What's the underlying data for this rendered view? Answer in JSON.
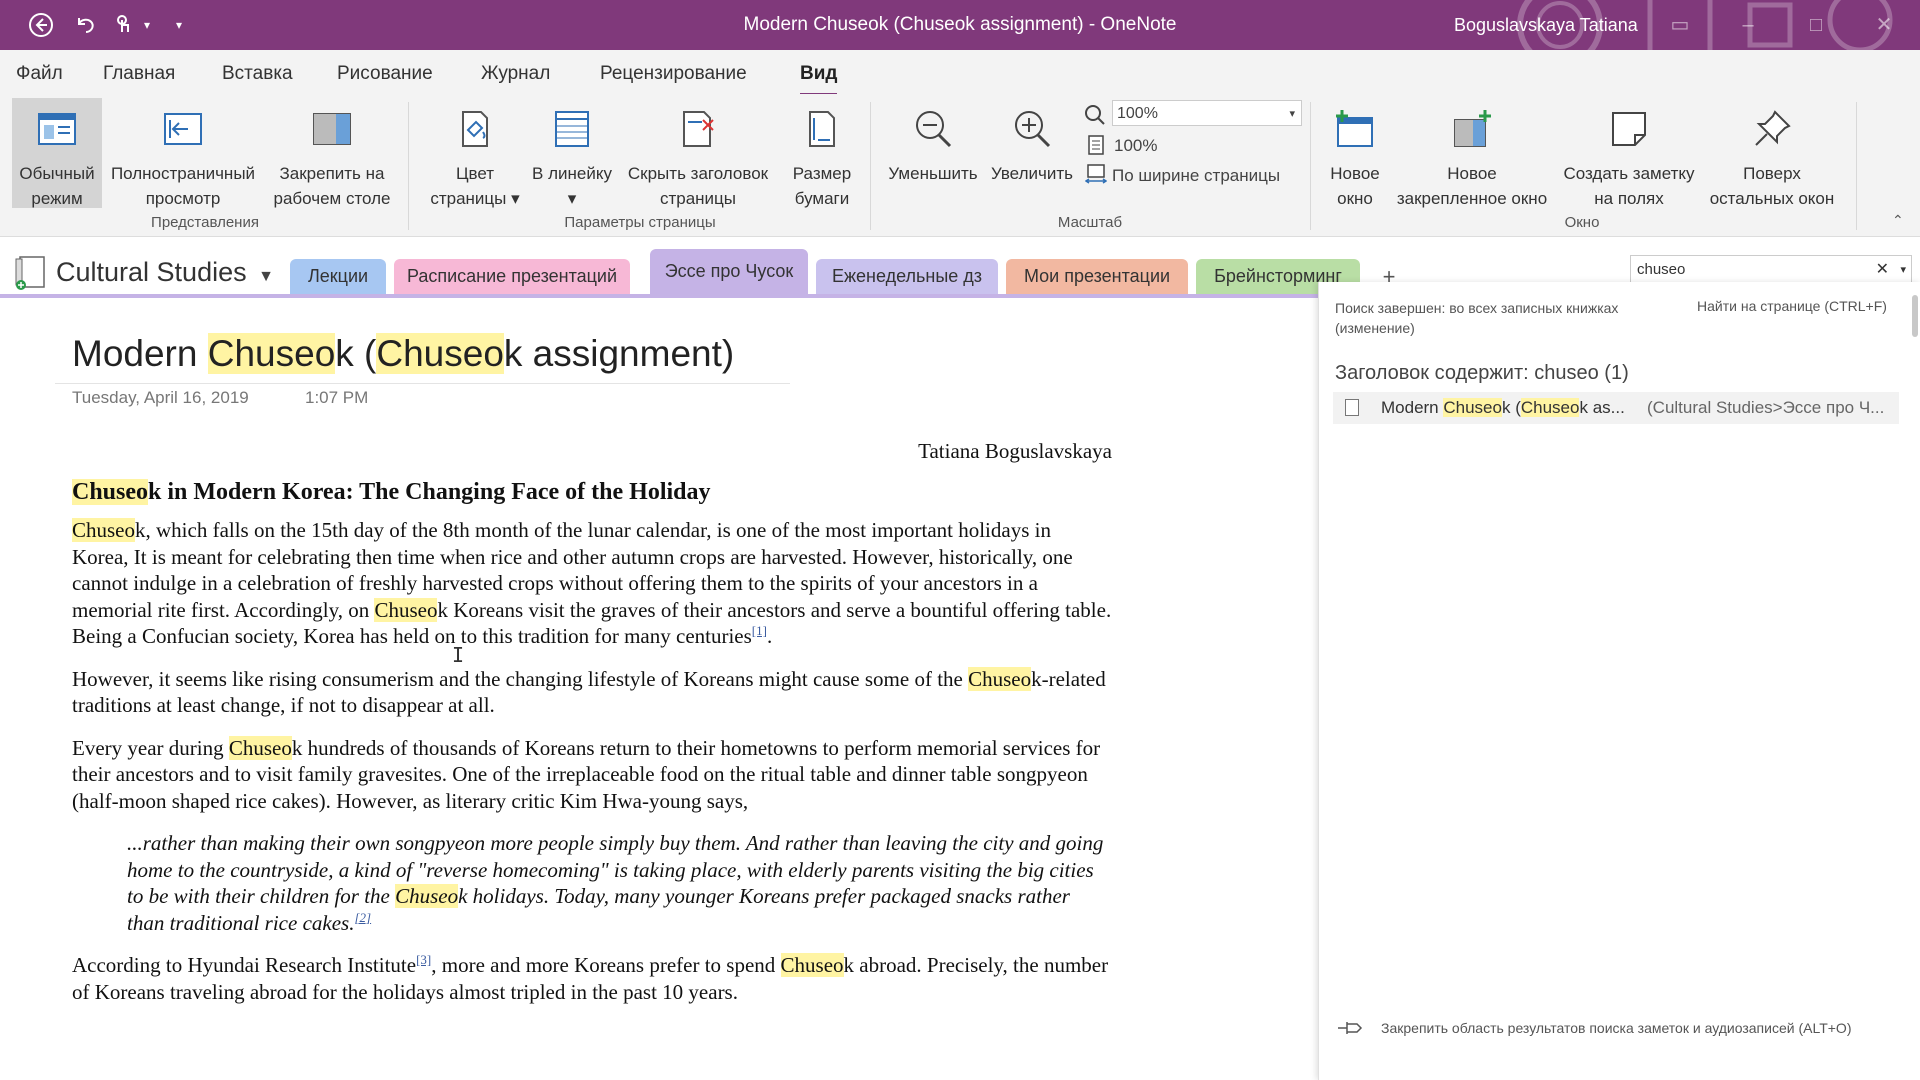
{
  "titlebar": {
    "title": "Modern Chuseok (Chuseok assignment)  -  OneNote",
    "user": "Boguslavskaya Tatiana",
    "quick_access": [
      "back-icon",
      "undo-icon",
      "touch-mode-icon",
      "dropdown-icon",
      "customize-icon"
    ]
  },
  "menu": [
    "Файл",
    "Главная",
    "Вставка",
    "Рисование",
    "Журнал",
    "Рецензирование",
    "Вид"
  ],
  "ribbon": {
    "buttons": [
      {
        "line1": "Обычный",
        "line2": "режим"
      },
      {
        "line1": "Полностраничный",
        "line2": "просмотр"
      },
      {
        "line1": "Закрепить на",
        "line2": "рабочем столе"
      },
      {
        "line1": "Цвет",
        "line2": "страницы ▾"
      },
      {
        "line1": "В линейку",
        "line2": "▾"
      },
      {
        "line1": "Скрыть заголовок",
        "line2": "страницы"
      },
      {
        "line1": "Размер",
        "line2": "бумаги"
      },
      {
        "line1": "Уменьшить",
        "line2": ""
      },
      {
        "line1": "Увеличить",
        "line2": ""
      },
      {
        "line1": "Новое",
        "line2": "окно"
      },
      {
        "line1": "Новое",
        "line2": "закрепленное окно"
      },
      {
        "line1": "Создать заметку",
        "line2": "на полях"
      },
      {
        "line1": "Поверх",
        "line2": "остальных окон"
      }
    ],
    "zoom_value": "100%",
    "zoom_100": "100%",
    "page_width": "По ширине страницы",
    "groups": [
      "Представления",
      "Параметры страницы",
      "Масштаб",
      "Окно"
    ]
  },
  "notebook": {
    "name": "Cultural Studies",
    "sections": [
      {
        "label": "Лекции",
        "color": "#a7c7f2"
      },
      {
        "label": "Расписание презентаций",
        "color": "#f7b8d6"
      },
      {
        "label": "Эссе про Чусок",
        "color": "#c5b3e6"
      },
      {
        "label": "Еженедельные дз",
        "color": "#c9c2ee"
      },
      {
        "label": "Мои презентации",
        "color": "#f2b8a1"
      },
      {
        "label": "Брейнсторминг",
        "color": "#b9dea5"
      }
    ],
    "add_section": "+",
    "search_value": "chuseo"
  },
  "page": {
    "title": {
      "hl1": "Chuseo",
      "t1": "Modern ",
      "t2": "k (",
      "hl2": "Chuseo",
      "t3": "k assignment)"
    },
    "date": "Tuesday, April 16, 2019",
    "time": "1:07 PM",
    "author": "Tatiana Boguslavskaya",
    "heading": {
      "hl": "Chuseo",
      "rest": "k in Modern Korea: The Changing Face of the Holiday"
    },
    "p1": {
      "hl1": "Chuseo",
      "a": "k, which falls on the 15th day of the 8th month of the lunar calendar, is one of the most important holidays in Korea, It is meant for celebrating then time when rice and other autumn crops are harvested. However, historically, one cannot indulge in a celebration of freshly harvested crops without offering them to the spirits of your ancestors in a memorial rite first. Accordingly, on ",
      "hl2": "Chuseo",
      "b": "k Koreans visit the graves of their ancestors and serve a bountiful offering table. Being a Confucian society, Korea has held on to this tradition for many centuries",
      "fn": "[1]",
      "c": "."
    },
    "p2": {
      "a": "However, it seems like rising consumerism and the changing lifestyle of Koreans might cause some of the ",
      "hl": "Chuseo",
      "b": "k-related traditions at least change, if not to disappear at all."
    },
    "p3": {
      "a": "Every year during ",
      "hl": "Chuseo",
      "b": "k hundreds of thousands of Koreans return to their hometowns to perform memorial services for their ancestors and to visit family gravesites. One of the irreplaceable food on the ritual table and dinner table songpyeon (half-moon shaped rice cakes). However, as literary critic Kim Hwa-young says,"
    },
    "quote": {
      "a": "...rather than making their own songpyeon more people simply buy them. And rather than leaving the city and going home to the countryside, a kind of \"reverse homecoming\" is taking place, with elderly parents visiting the big cities to be with their children for the ",
      "hl": "Chuseo",
      "b": "k holidays. Today, many younger Koreans prefer packaged snacks rather than traditional rice cakes.",
      "fn": "[2]"
    },
    "p4": {
      "a": "According to Hyundai Research Institute",
      "fn": "[3]",
      "b": ", more and more Koreans prefer to spend ",
      "hl": "Chuseo",
      "c": "k abroad. Precisely, the number of Koreans traveling abroad for the holidays almost tripled in the past 10 years."
    }
  },
  "search_pane": {
    "status": "Поиск завершен: во всех записных книжках (изменение)",
    "find_on_page": "Найти на странице (CTRL+F)",
    "header": "Заголовок содержит: chuseo (1)",
    "result": {
      "a": "Modern ",
      "hl1": "Chuseo",
      "b": "k (",
      "hl2": "Chuseo",
      "c": "k as...",
      "location": "(Cultural Studies>Эссе про Ч..."
    },
    "pin_text": "Закрепить область результатов поиска заметок и аудиозаписей (ALT+O)"
  },
  "colors": {
    "accent": "#80397b",
    "highlight": "#fff4a3"
  }
}
